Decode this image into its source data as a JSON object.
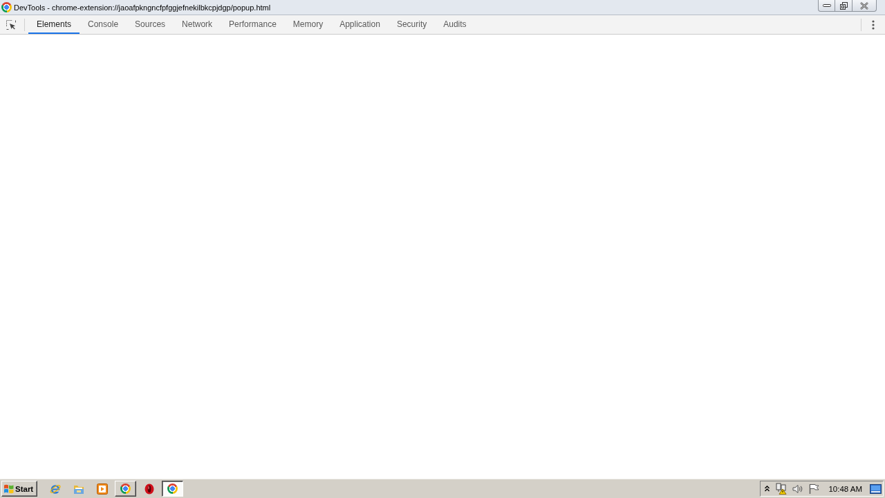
{
  "window": {
    "title": "DevTools - chrome-extension://jaoafpkngncfpfggjefnekilbkcpjdgp/popup.html"
  },
  "tabs": [
    {
      "label": "Elements",
      "selected": true
    },
    {
      "label": "Console",
      "selected": false
    },
    {
      "label": "Sources",
      "selected": false
    },
    {
      "label": "Network",
      "selected": false
    },
    {
      "label": "Performance",
      "selected": false
    },
    {
      "label": "Memory",
      "selected": false
    },
    {
      "label": "Application",
      "selected": false
    },
    {
      "label": "Security",
      "selected": false
    },
    {
      "label": "Audits",
      "selected": false
    }
  ],
  "taskbar": {
    "start": "Start",
    "items": [
      {
        "kind": "ie",
        "open": false,
        "selected": false
      },
      {
        "kind": "folder",
        "open": false,
        "selected": false
      },
      {
        "kind": "media",
        "open": false,
        "selected": false
      },
      {
        "kind": "chrome",
        "open": true,
        "selected": false
      },
      {
        "kind": "opera",
        "open": false,
        "selected": false
      },
      {
        "kind": "chrome",
        "open": true,
        "selected": true
      }
    ],
    "clock": "10:48 AM"
  }
}
